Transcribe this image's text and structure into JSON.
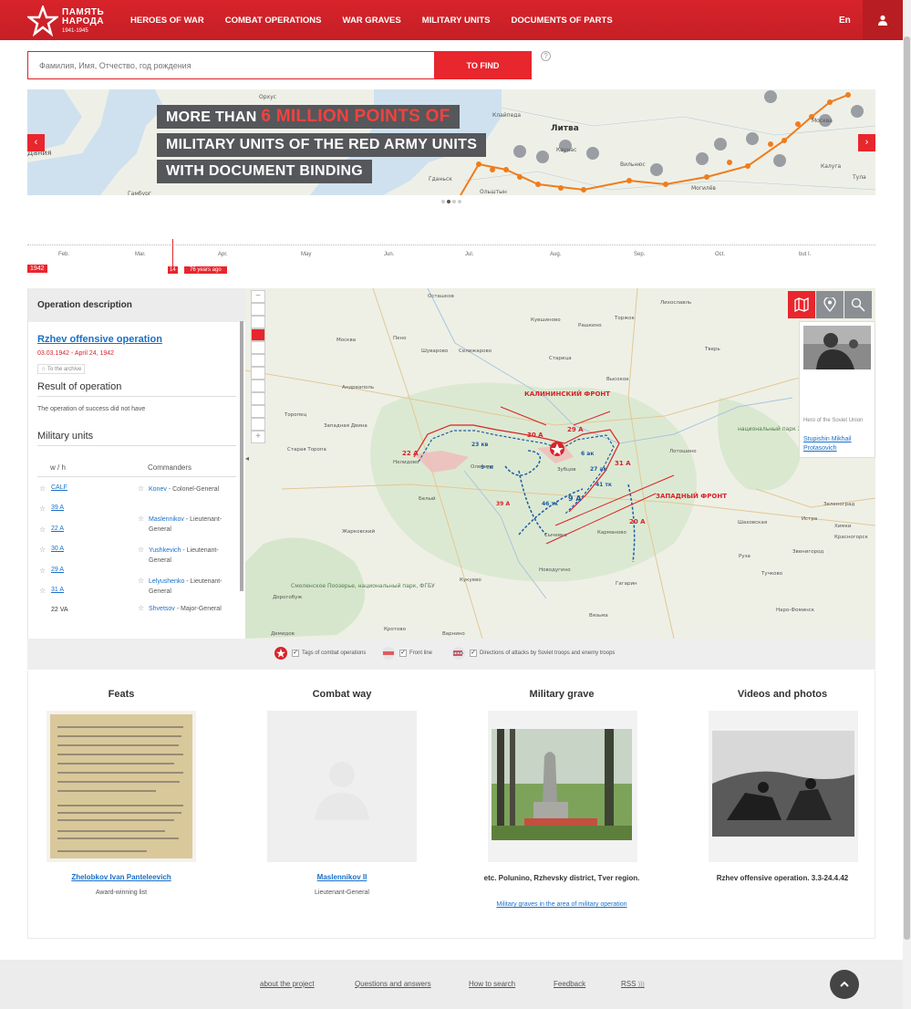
{
  "logo": {
    "line1": "ПАМЯТЬ",
    "line2": "НАРОДА",
    "years": "1941-1945"
  },
  "nav": [
    "HEROES OF WAR",
    "COMBAT OPERATIONS",
    "WAR GRAVES",
    "MILITARY UNITS",
    "DOCUMENTS OF PARTS"
  ],
  "lang": "En",
  "search": {
    "placeholder": "Фамилия, Имя, Отчество, год рождения",
    "button": "TO FIND",
    "help": "?"
  },
  "banner": {
    "line1_pre": "MORE THAN ",
    "line1_hl": "6 MILLION POINTS OF",
    "line2": "MILITARY UNITS OF THE RED ARMY UNITS",
    "line3": "WITH DOCUMENT BINDING",
    "map_labels": [
      "Литва",
      "Дания",
      "Клайпеда",
      "Каунас",
      "Вильнюс",
      "Гданьск",
      "Калуга",
      "Тула",
      "Москва",
      "Ольштын",
      "Гамбург",
      "Могилёв",
      "Орхус"
    ]
  },
  "timeline": {
    "months": [
      "Feb.",
      "Mar.",
      "Apr.",
      "May",
      "Jun.",
      "Jul.",
      "Aug.",
      "Sep.",
      "Oct.",
      "but I."
    ],
    "year": "1942",
    "day": "14",
    "ago": "76 years ago"
  },
  "operation": {
    "header": "Operation description",
    "title": "Rzhev offensive operation",
    "dates": "03.03.1942 - April 24, 1942",
    "archive": "To the archive",
    "result_title": "Result of operation",
    "result_text": "The operation of success did not have",
    "units_title": "Military units",
    "col_units": "w / h",
    "col_commanders": "Commanders",
    "units": [
      {
        "name": "CALF",
        "link": true,
        "commander": "Konev",
        "rank": " - Colonel-General"
      },
      {
        "name": "39 A",
        "link": true,
        "commander": "Maslennikov",
        "rank": " - Lieutenant-General"
      },
      {
        "name": "22 A",
        "link": true,
        "commander": "Yushkevich",
        "rank": " - Lieutenant-General"
      },
      {
        "name": "30 A",
        "link": true,
        "commander": "Lelyushenko",
        "rank": " - Lieutenant-General"
      },
      {
        "name": "29 A",
        "link": true,
        "commander": "Shvetsov",
        "rank": " - Major-General"
      },
      {
        "name": "31 A",
        "link": true,
        "commander": "",
        "rank": ""
      },
      {
        "name": "22 VA",
        "link": false,
        "commander": "",
        "rank": ""
      }
    ]
  },
  "map": {
    "fronts": [
      "КАЛИНИНСКИЙ ФРОНТ",
      "ЗАПАДНЫЙ ФРОНТ"
    ],
    "armies": [
      "22 А",
      "30 А",
      "29 А",
      "31 А",
      "39 А",
      "20 А",
      "9 А",
      "23 кв",
      "46 тк",
      "41 тк",
      "27 ак",
      "6 ак",
      "9 тк"
    ],
    "towns": [
      "Осташков",
      "Кувшиново",
      "Торжок",
      "Лихославль",
      "Рашкино",
      "Тверь",
      "Москва",
      "Пено",
      "Шуварово",
      "Селижарово",
      "Старица",
      "Высокое",
      "Андреаполь",
      "Торопец",
      "Западная Двина",
      "Старая Торопа",
      "Нелидово",
      "Белый",
      "Оленино",
      "Зубцов",
      "Сычевка",
      "Кармановo",
      "Новодугино",
      "Гагарин",
      "Вязьма",
      "Жарковский",
      "Лотошино",
      "Шаховская",
      "Истра",
      "Зеленоград",
      "Химки",
      "Красногорск",
      "Звенигород",
      "Руза",
      "Тучково",
      "Дорогобуж",
      "Наро-Фоминск",
      "Кукуево",
      "Демидов",
      "Кротово",
      "Варнино",
      "Смоленское Поозерье",
      "Ярцево",
      "Сафоново",
      "Духовщина",
      "Погорелое",
      "Чертолино",
      "Осуга",
      "Ржев",
      "Холм-Жирковский",
      "Никитино",
      "Жуки",
      "Волга",
      "Московское море",
      "Красное Ржев",
      "Алешково",
      "Пола",
      "Верхнее",
      "Осинники",
      "Батурино",
      "Куньи"
    ],
    "park": "национальный парк Завидово",
    "park2": "Смоленское Поозерье, национальный парк, ФГБУ",
    "hero_caption": "Hero of the Soviet Union",
    "hero_name": "Stupishin Mikhail Protasovich"
  },
  "legend": {
    "tags": "Tags of combat operations",
    "front": "Front line",
    "dirs": "Directions of attacks by Soviet troops and enemy troops"
  },
  "cards": {
    "feats_title": "Feats",
    "feats_link": "Zhelobkov Ivan Panteleevich",
    "feats_sub": "Award-winning list",
    "combat_title": "Combat way",
    "combat_link": "Maslennikov II",
    "combat_sub": "Lieutenant-General",
    "grave_title": "Military grave",
    "grave_text": "etc. Polunino, Rzhevsky district, Tver region.",
    "grave_link": "Military graves in the area of military operation",
    "video_title": "Videos and photos",
    "video_text": "Rzhev offensive operation. 3.3-24.4.42"
  },
  "footer": [
    "about the project",
    "Questions and answers",
    "How to search",
    "Feedback",
    "RSS"
  ],
  "colors": {
    "brand": "#d8232a",
    "link": "#1a6fc9",
    "route": "#f07c1c"
  }
}
